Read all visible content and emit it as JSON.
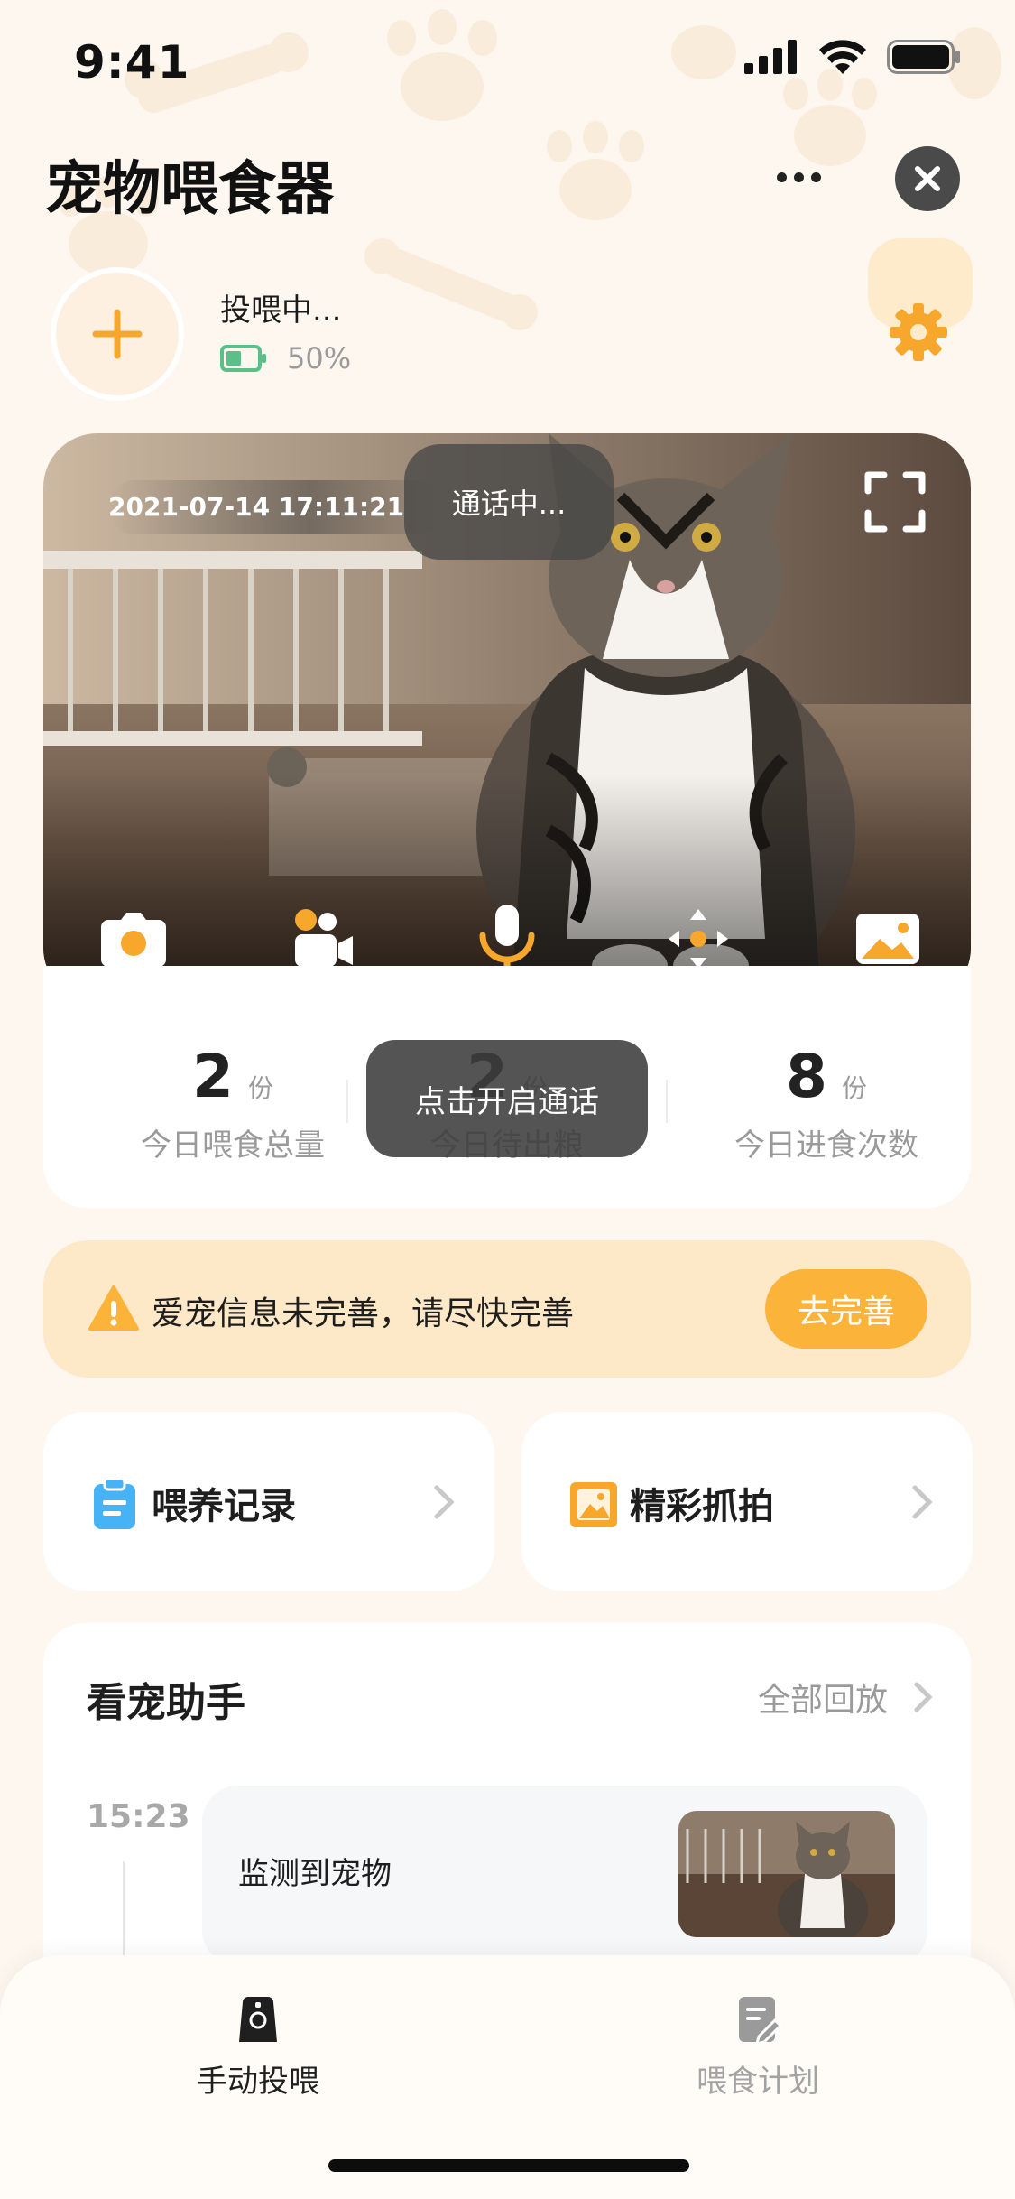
{
  "status_bar": {
    "time": "9:41"
  },
  "header": {
    "title": "宠物喂食器"
  },
  "device": {
    "feed_status": "投喂中...",
    "battery": "50%",
    "battery_level": 0.5
  },
  "video": {
    "timestamp": "2021-07-14 17:11:21",
    "call_status": "通话中...",
    "controls": [
      "camera-icon",
      "video-record-icon",
      "microphone-icon",
      "direction-pad-icon",
      "gallery-icon"
    ]
  },
  "stats": [
    {
      "value": "2",
      "unit": "份",
      "label": "今日喂食总量"
    },
    {
      "value": "2",
      "unit": "份",
      "label": "今日待出粮"
    },
    {
      "value": "8",
      "unit": "份",
      "label": "今日进食次数"
    }
  ],
  "toast": "点击开启通话",
  "alert": {
    "text": "爱宠信息未完善，请尽快完善",
    "button": "去完善"
  },
  "quick_links": [
    {
      "label": "喂养记录",
      "icon": "clipboard-icon"
    },
    {
      "label": "精彩抓拍",
      "icon": "photo-icon"
    }
  ],
  "assistant": {
    "title": "看宠助手",
    "playback": "全部回放",
    "events": [
      {
        "time": "15:23",
        "label": "监测到宠物"
      }
    ]
  },
  "tabs": [
    {
      "label": "手动投喂",
      "active": true
    },
    {
      "label": "喂食计划",
      "active": false
    }
  ],
  "colors": {
    "accent": "#fbb339",
    "background": "#fdf7ef",
    "battery": "#5cbf8a"
  }
}
